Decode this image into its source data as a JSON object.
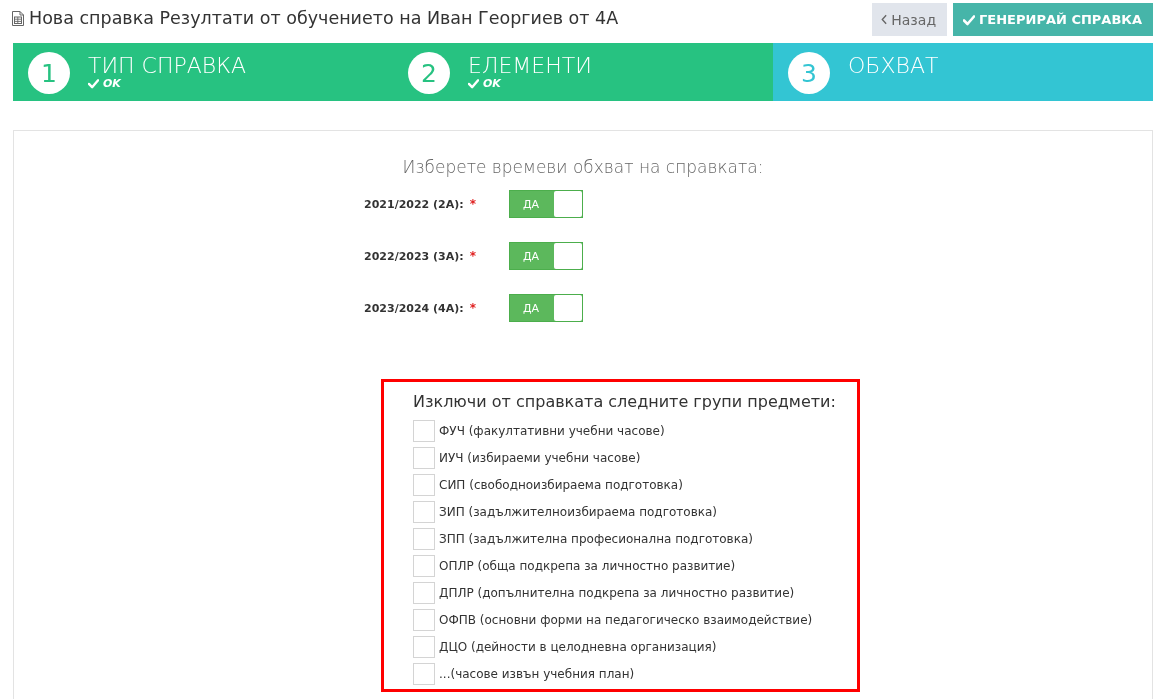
{
  "page": {
    "title": "Нова справка Резултати от обучението на Иван Георгиев от 4А"
  },
  "buttons": [
    {
      "kind": "back",
      "label": "Назад"
    },
    {
      "kind": "primary",
      "label": "ГЕНЕРИРАЙ СПРАВКА"
    }
  ],
  "steps": [
    {
      "number": "1",
      "title": "ТИП СПРАВКА",
      "completed": true,
      "status": "OK"
    },
    {
      "number": "2",
      "title": "ЕЛЕМЕНТИ",
      "completed": true,
      "status": "OK"
    },
    {
      "number": "3",
      "title": "ОБХВАТ",
      "completed": false
    }
  ],
  "scope": {
    "heading": "Изберете времеви обхват на справката:",
    "periods": [
      {
        "label": "2021/2022 (2А):",
        "required_mark": "*",
        "on": true,
        "switch_label": "ДА"
      },
      {
        "label": "2022/2023 (3А):",
        "required_mark": "*",
        "on": true,
        "switch_label": "ДА"
      },
      {
        "label": "2023/2024 (4А):",
        "required_mark": "*",
        "on": true,
        "switch_label": "ДА"
      }
    ]
  },
  "exclusions": {
    "heading": "Изключи от справката следните групи предмети:",
    "highlighted": true,
    "groups": [
      {
        "label": "ФУЧ (факултативни учебни часове)",
        "checked": false
      },
      {
        "label": "ИУЧ (избираеми учебни часове)",
        "checked": false
      },
      {
        "label": "СИП (свободноизбираема подготовка)",
        "checked": false
      },
      {
        "label": "ЗИП (задължителноизбираема подготовка)",
        "checked": false
      },
      {
        "label": "ЗПП (задължителна професионална подготовка)",
        "checked": false
      },
      {
        "label": "ОПЛР (обща подкрепа за личностно развитие)",
        "checked": false
      },
      {
        "label": "ДПЛР (допълнителна подкрепа за личностно развитие)",
        "checked": false
      },
      {
        "label": "ОФПВ (основни форми на педагогическо взаимодействие)",
        "checked": false
      },
      {
        "label": "ДЦО (дейности в целодневна организация)",
        "checked": false
      },
      {
        "label": "...(часове извън учебния план)",
        "checked": false
      }
    ]
  }
}
